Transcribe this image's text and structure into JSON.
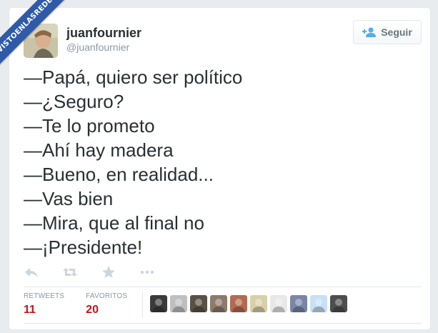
{
  "watermark": {
    "text": "VISTOENLASREDES"
  },
  "user": {
    "name": "juanfournier",
    "handle": "@juanfournier",
    "avatar_icon": "profile-photo"
  },
  "follow_button": {
    "label": "Seguir",
    "icon": "add-user-icon"
  },
  "tweet": {
    "lines": [
      "—Papá, quiero ser político",
      "—¿Seguro?",
      "—Te lo prometo",
      "—Ahí hay madera",
      "—Bueno, en realidad...",
      "—Vas bien",
      "—Mira, que al final no",
      "—¡Presidente!"
    ]
  },
  "actions": [
    {
      "name": "reply-icon"
    },
    {
      "name": "retweet-icon"
    },
    {
      "name": "favorite-icon"
    },
    {
      "name": "more-icon"
    }
  ],
  "stats": {
    "retweets_label": "RETWEETS",
    "retweets_value": "11",
    "favorites_label": "FAVORITOS",
    "favorites_value": "20"
  },
  "favoriters": [
    {
      "name": "favoriter-avatar-1",
      "color": "#3a3a3a"
    },
    {
      "name": "favoriter-avatar-2",
      "color": "#bfbfbf"
    },
    {
      "name": "favoriter-avatar-3",
      "color": "#5a5045"
    },
    {
      "name": "favoriter-avatar-4",
      "color": "#8c7a6b"
    },
    {
      "name": "favoriter-avatar-5",
      "color": "#b36b4f"
    },
    {
      "name": "favoriter-avatar-6",
      "color": "#d9cfa8"
    },
    {
      "name": "favoriter-avatar-7",
      "color": "#e8e8e8"
    },
    {
      "name": "favoriter-avatar-8",
      "color": "#7a86a6"
    },
    {
      "name": "favoriter-avatar-9",
      "color": "#c7e0f5"
    },
    {
      "name": "favoriter-avatar-10",
      "color": "#4d4d4d"
    }
  ],
  "colors": {
    "accent": "#55acee",
    "stat_value": "#cc1111",
    "ribbon": "#2e5aa8"
  }
}
